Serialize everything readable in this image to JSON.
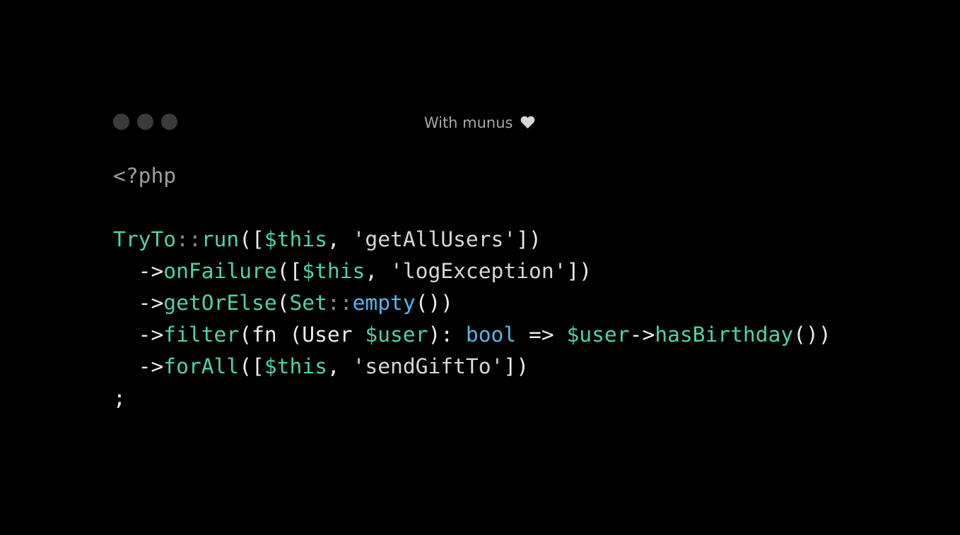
{
  "window": {
    "title": "With munus",
    "title_icon": "heart-icon",
    "dot_color": "#3c3c3c"
  },
  "code": {
    "language": "php",
    "lines": [
      [
        {
          "t": "<?php",
          "c": "c-tag"
        }
      ],
      [],
      [
        {
          "t": "TryTo",
          "c": "c-class"
        },
        {
          "t": "::",
          "c": "c-op"
        },
        {
          "t": "run",
          "c": "c-method"
        },
        {
          "t": "([",
          "c": "c-punct"
        },
        {
          "t": "$this",
          "c": "c-var"
        },
        {
          "t": ", ",
          "c": "c-punct"
        },
        {
          "t": "'getAllUsers'",
          "c": "c-str"
        },
        {
          "t": "])",
          "c": "c-punct"
        }
      ],
      [
        {
          "t": "  ->",
          "c": "c-plain"
        },
        {
          "t": "onFailure",
          "c": "c-method"
        },
        {
          "t": "([",
          "c": "c-punct"
        },
        {
          "t": "$this",
          "c": "c-var"
        },
        {
          "t": ", ",
          "c": "c-punct"
        },
        {
          "t": "'logException'",
          "c": "c-str"
        },
        {
          "t": "])",
          "c": "c-punct"
        }
      ],
      [
        {
          "t": "  ->",
          "c": "c-plain"
        },
        {
          "t": "getOrElse",
          "c": "c-method"
        },
        {
          "t": "(",
          "c": "c-punct"
        },
        {
          "t": "Set",
          "c": "c-class"
        },
        {
          "t": "::",
          "c": "c-op"
        },
        {
          "t": "empty",
          "c": "c-method-blue"
        },
        {
          "t": "())",
          "c": "c-punct"
        }
      ],
      [
        {
          "t": "  ->",
          "c": "c-plain"
        },
        {
          "t": "filter",
          "c": "c-method"
        },
        {
          "t": "(fn (User ",
          "c": "c-plain"
        },
        {
          "t": "$user",
          "c": "c-var"
        },
        {
          "t": "): ",
          "c": "c-plain"
        },
        {
          "t": "bool",
          "c": "c-kw"
        },
        {
          "t": " => ",
          "c": "c-plain"
        },
        {
          "t": "$user",
          "c": "c-var"
        },
        {
          "t": "->",
          "c": "c-plain"
        },
        {
          "t": "hasBirthday",
          "c": "c-method"
        },
        {
          "t": "())",
          "c": "c-punct"
        }
      ],
      [
        {
          "t": "  ->",
          "c": "c-plain"
        },
        {
          "t": "forAll",
          "c": "c-method"
        },
        {
          "t": "([",
          "c": "c-punct"
        },
        {
          "t": "$this",
          "c": "c-var"
        },
        {
          "t": ", ",
          "c": "c-punct"
        },
        {
          "t": "'sendGiftTo'",
          "c": "c-str"
        },
        {
          "t": "])",
          "c": "c-punct"
        }
      ],
      [
        {
          "t": ";",
          "c": "c-plain"
        }
      ]
    ]
  }
}
